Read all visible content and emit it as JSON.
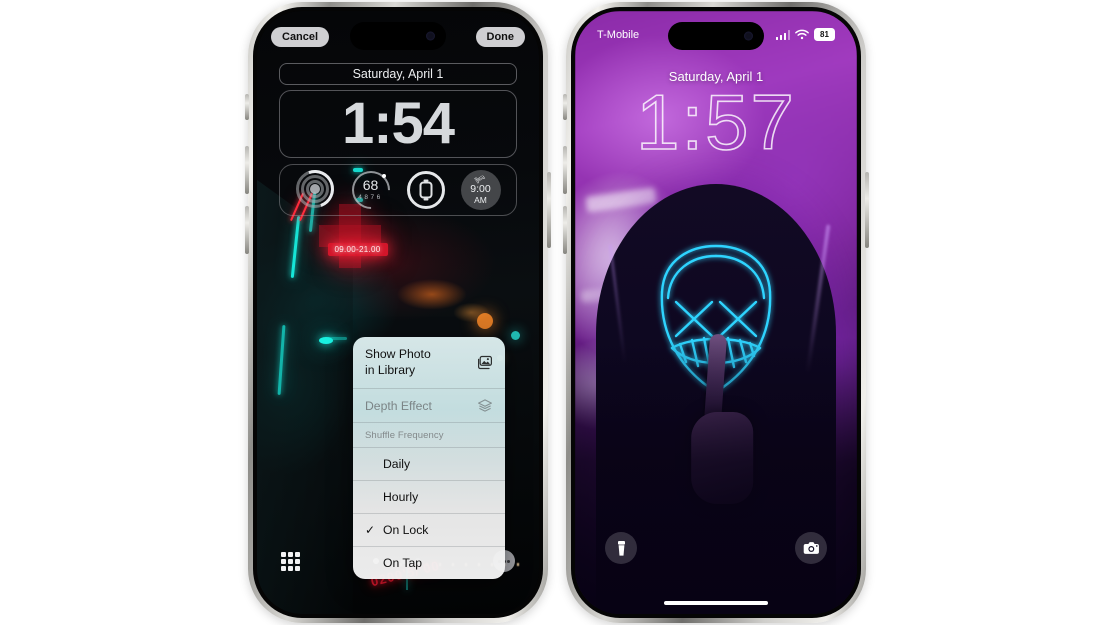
{
  "left_phone": {
    "edit_bar": {
      "cancel": "Cancel",
      "done": "Done"
    },
    "date": "Saturday, April 1",
    "clock": "1:54",
    "widgets": [
      {
        "name": "activity-rings-widget",
        "label": ""
      },
      {
        "name": "weather-widget",
        "temp": "68",
        "low": "48",
        "high": "76"
      },
      {
        "name": "watch-battery-widget",
        "label": ""
      },
      {
        "name": "alarm-widget",
        "time": "9:00",
        "ampm": "AM",
        "icon": "bed-icon"
      }
    ],
    "wallpaper": {
      "description": "dark neon alley",
      "neon_sign": "09.00-21.00",
      "graffiti": "0200'5/'00"
    },
    "context_menu": {
      "items": [
        {
          "label": "Show Photo\nin Library",
          "icon": "photo-library-icon",
          "disabled": false,
          "checked": false,
          "type": "item"
        },
        {
          "label": "Depth Effect",
          "icon": "layers-icon",
          "disabled": true,
          "checked": false,
          "type": "item"
        },
        {
          "label": "Shuffle Frequency",
          "type": "header"
        },
        {
          "label": "Daily",
          "disabled": false,
          "checked": false,
          "type": "item"
        },
        {
          "label": "Hourly",
          "disabled": false,
          "checked": false,
          "type": "item"
        },
        {
          "label": "On Lock",
          "disabled": false,
          "checked": true,
          "type": "item"
        },
        {
          "label": "On Tap",
          "disabled": false,
          "checked": false,
          "type": "item"
        }
      ],
      "check_glyph": "✓"
    },
    "bottom_bar": {
      "grid_icon": "grid-icon",
      "page_dots": 4,
      "active_dot": 1,
      "more_icon": "more-ellipsis-icon"
    }
  },
  "right_phone": {
    "status": {
      "carrier": "T-Mobile",
      "battery": "81",
      "signal_icon": "cellular-signal-icon",
      "wifi_icon": "wifi-icon"
    },
    "date": "Saturday, April 1",
    "clock": "1:57",
    "wallpaper": {
      "description": "neon LED purge mask portrait, purple"
    },
    "bottom": {
      "left_icon": "flashlight-icon",
      "right_icon": "camera-icon"
    }
  },
  "colors": {
    "neon_cyan": "#16e6d8",
    "neon_red": "#ff2d3d",
    "purple": "#8b2ba8",
    "mask_blue": "#29c8ff"
  }
}
